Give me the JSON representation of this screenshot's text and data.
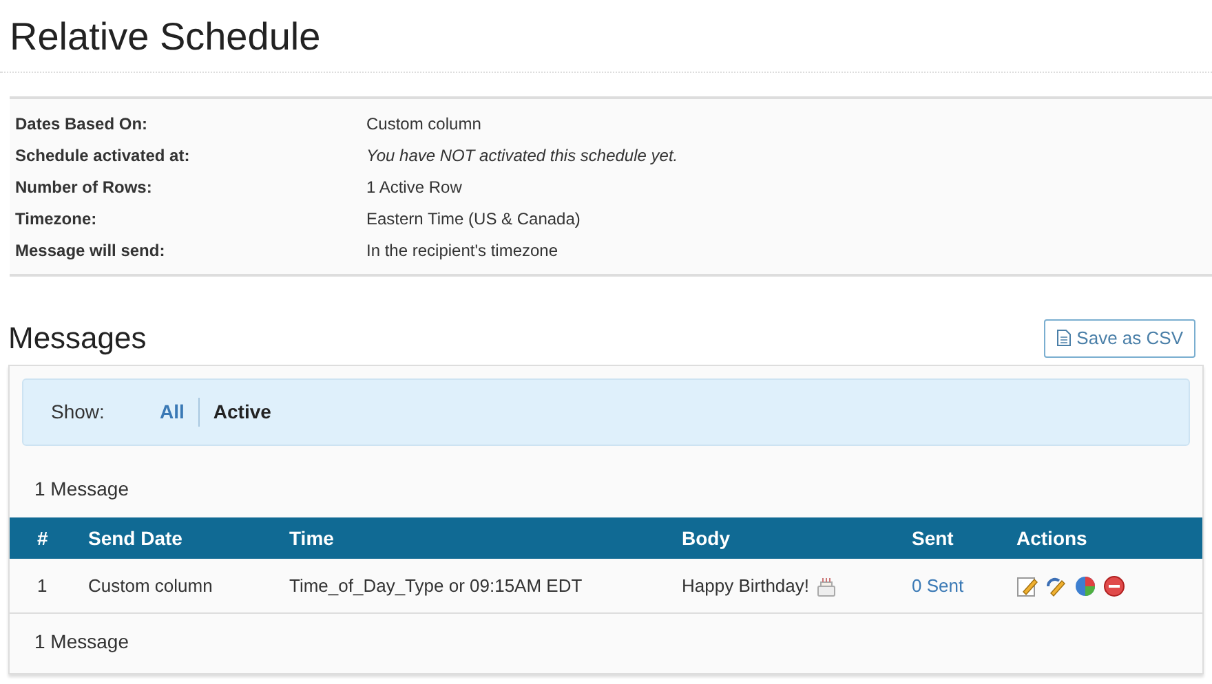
{
  "title": "Relative Schedule",
  "details": [
    {
      "label": "Dates Based On:",
      "value": "Custom column",
      "italic": false
    },
    {
      "label": "Schedule activated at:",
      "value": "You have NOT activated this schedule yet.",
      "italic": true
    },
    {
      "label": "Number of Rows:",
      "value": "1 Active Row",
      "italic": false
    },
    {
      "label": "Timezone:",
      "value": "Eastern Time (US & Canada)",
      "italic": false
    },
    {
      "label": "Message will send:",
      "value": "In the recipient's timezone",
      "italic": false
    }
  ],
  "messages": {
    "heading": "Messages",
    "export_button": "Save as CSV",
    "filter_label": "Show:",
    "filters": [
      {
        "label": "All",
        "selected": false
      },
      {
        "label": "Active",
        "selected": true
      }
    ],
    "count_top": "1 Message",
    "count_bottom": "1 Message",
    "columns": [
      "#",
      "Send Date",
      "Time",
      "Body",
      "Sent",
      "Actions"
    ],
    "rows": [
      {
        "number": "1",
        "send_date": "Custom column",
        "time": "Time_of_Day_Type or 09:15AM EDT",
        "body": "Happy Birthday!",
        "sent": "0 Sent"
      }
    ]
  }
}
